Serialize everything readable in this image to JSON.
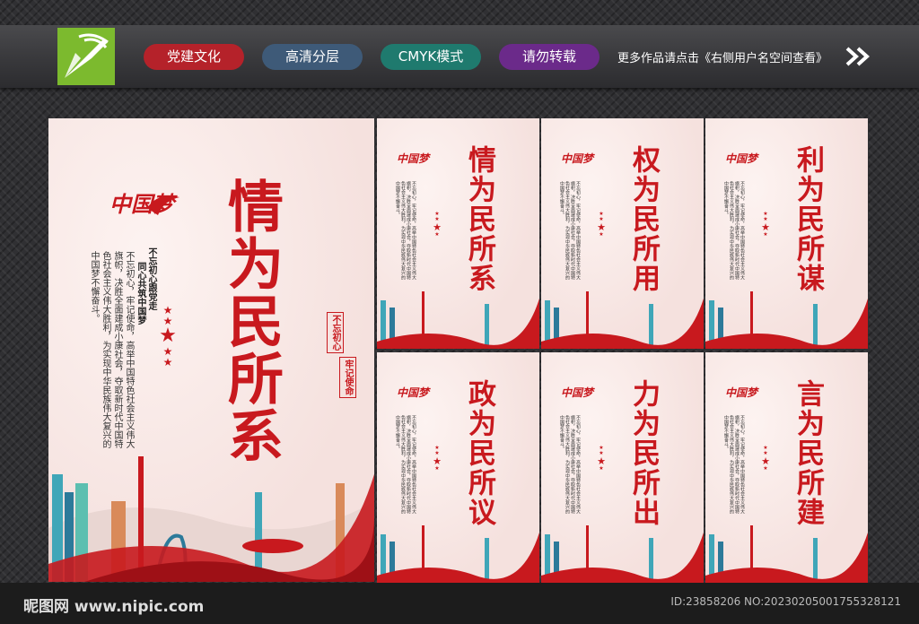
{
  "header": {
    "tags": [
      {
        "label": "党建文化",
        "color": "#b5222a"
      },
      {
        "label": "高清分层",
        "color": "#3e5a78"
      },
      {
        "label": "CMYK模式",
        "color": "#1f7a6e"
      },
      {
        "label": "请勿转载",
        "color": "#6b2a8a"
      }
    ],
    "note": "更多作品请点击《右侧用户名空间查看》"
  },
  "main_poster": {
    "title": "情为民所系",
    "slogan_left": "不忘初心跟党走",
    "slogan_right": "同心共筑中国梦",
    "body": "不忘初心，牢记使命，高举中国特色社会主义伟大旗帜，决胜全面建成小康社会，夺取新时代中国特色社会主义伟大胜利，为实现中华民族伟大复兴的中国梦不懈奋斗。",
    "seal_1": "不忘初心",
    "seal_2": "牢记使命",
    "logo_text": "中国梦"
  },
  "small_posters": [
    {
      "title": "情为民所系"
    },
    {
      "title": "权为民所用"
    },
    {
      "title": "利为民所谋"
    },
    {
      "title": "政为民所议"
    },
    {
      "title": "力为民所出"
    },
    {
      "title": "言为民所建"
    }
  ],
  "footer": {
    "site": "昵图网 www.nipic.com",
    "id_text": "ID:23858206 NO:20230205001755328121"
  },
  "colors": {
    "accent": "#c8191e",
    "logo_green": "#7cba2e"
  }
}
